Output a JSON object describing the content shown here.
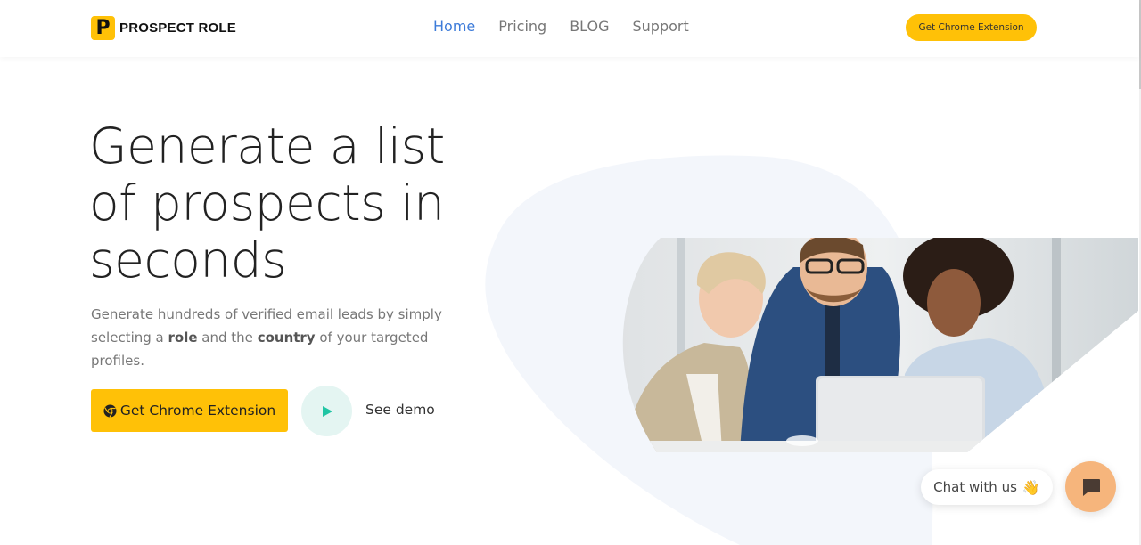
{
  "header": {
    "logo_letter": "P",
    "brand": "PROSPECT ROLE",
    "nav": [
      {
        "label": "Home",
        "active": true
      },
      {
        "label": "Pricing",
        "active": false
      },
      {
        "label": "BLOG",
        "active": false
      },
      {
        "label": "Support",
        "active": false
      }
    ],
    "cta_label": "Get Chrome Extension"
  },
  "hero": {
    "title_lines": [
      "Generate a list",
      "of prospects in",
      "seconds"
    ],
    "subtitle_part1": "Generate hundreds of verified email leads by simply selecting a ",
    "subtitle_bold1": "role",
    "subtitle_part2": " and the ",
    "subtitle_bold2": "country",
    "subtitle_part3": " of your targeted profiles.",
    "cta_label": "Get Chrome Extension",
    "demo_label": "See demo"
  },
  "chat": {
    "bubble_label": "Chat with us",
    "wave_emoji": "👋"
  },
  "colors": {
    "accent": "#ffc107",
    "nav_active": "#3d7bd9",
    "play_bg": "#e4f5f2",
    "play_icon": "#20c5a4",
    "chat_launcher": "#f6b57c",
    "blob": "#f3f6fb"
  }
}
